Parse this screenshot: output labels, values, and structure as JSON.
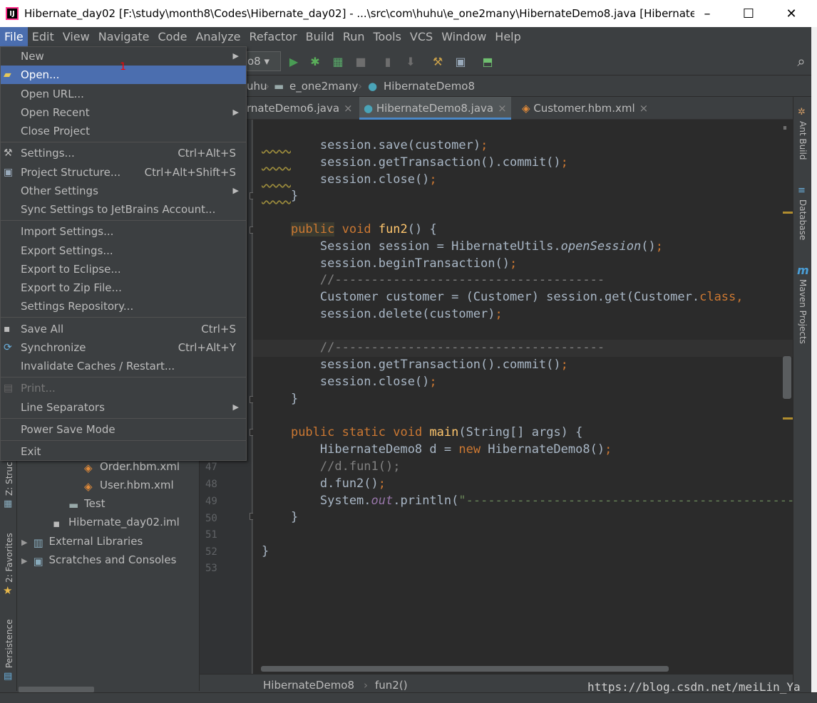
{
  "window": {
    "title": "Hibernate_day02 [F:\\study\\month8\\Codes\\Hibernate_day02] - ...\\src\\com\\huhu\\e_one2many\\HibernateDemo8.java [Hibernate...",
    "minimize": "–",
    "maximize": "☐",
    "close": "✕"
  },
  "menubar": [
    "File",
    "Edit",
    "View",
    "Navigate",
    "Code",
    "Analyze",
    "Refactor",
    "Build",
    "Run",
    "Tools",
    "VCS",
    "Window",
    "Help"
  ],
  "toolbar": {
    "run_config": "o8 ▾"
  },
  "breadcrumbs": [
    "uhu",
    "e_one2many",
    "HibernateDemo8"
  ],
  "tabs": [
    {
      "label": "rnateDemo6.java",
      "close": "×"
    },
    {
      "label": "HibernateDemo8.java",
      "close": "×"
    },
    {
      "label": "Customer.hbm.xml",
      "close": "×"
    }
  ],
  "file_menu": {
    "annotation": "1",
    "items": [
      {
        "label": "New",
        "shortcut": "",
        "submenu": true
      },
      {
        "label": "Open...",
        "shortcut": ""
      },
      {
        "label": "Open URL...",
        "shortcut": ""
      },
      {
        "label": "Open Recent",
        "shortcut": "",
        "submenu": true
      },
      {
        "label": "Close Project",
        "shortcut": ""
      },
      {
        "label": "Settings...",
        "shortcut": "Ctrl+Alt+S"
      },
      {
        "label": "Project Structure...",
        "shortcut": "Ctrl+Alt+Shift+S"
      },
      {
        "label": "Other Settings",
        "shortcut": "",
        "submenu": true
      },
      {
        "label": "Sync Settings to JetBrains Account...",
        "shortcut": ""
      },
      {
        "label": "Import Settings...",
        "shortcut": ""
      },
      {
        "label": "Export Settings...",
        "shortcut": ""
      },
      {
        "label": "Export to Eclipse...",
        "shortcut": ""
      },
      {
        "label": "Export to Zip File...",
        "shortcut": ""
      },
      {
        "label": "Settings Repository...",
        "shortcut": ""
      },
      {
        "label": "Save All",
        "shortcut": "Ctrl+S"
      },
      {
        "label": "Synchronize",
        "shortcut": "Ctrl+Alt+Y"
      },
      {
        "label": "Invalidate Caches / Restart...",
        "shortcut": ""
      },
      {
        "label": "Print...",
        "shortcut": ""
      },
      {
        "label": "Line Separators",
        "shortcut": "",
        "submenu": true
      },
      {
        "label": "Power Save Mode",
        "shortcut": ""
      },
      {
        "label": "Exit",
        "shortcut": ""
      }
    ]
  },
  "project_tree": [
    {
      "label": "Order.hbm.xml"
    },
    {
      "label": "User.hbm.xml"
    },
    {
      "label": "Test"
    },
    {
      "label": "Hibernate_day02.iml"
    },
    {
      "label": "External Libraries"
    },
    {
      "label": "Scratches and Consoles"
    }
  ],
  "left_tools": [
    "Z: Struc",
    "2: Favorites",
    "Persistence"
  ],
  "right_tools": [
    "Ant Build",
    "Database",
    "Maven Projects"
  ],
  "line_numbers": [
    "47",
    "48",
    "49",
    "50",
    "51",
    "52",
    "53"
  ],
  "status": {
    "class_crumb": "HibernateDemo8",
    "method_crumb": "fun2()"
  },
  "watermark": "https://blog.csdn.net/meiLin_Ya",
  "colors": {
    "accent": "#4b6eaf",
    "keyword": "#cc7832",
    "function": "#ffc66d",
    "comment": "#808080",
    "string": "#6a8759",
    "background": "#2b2b2b"
  }
}
